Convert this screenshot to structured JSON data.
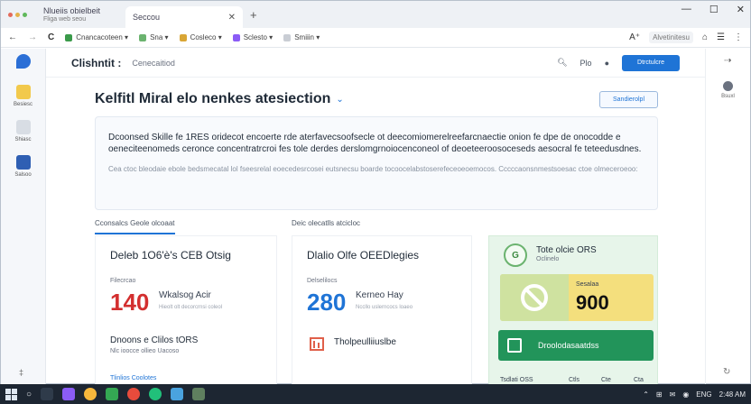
{
  "browser": {
    "tab_inactive_label": "Nlueiis obielbeit",
    "tab_inactive_sub": "Fliga web seou",
    "tab_active_label": "Seccou",
    "bookmarks": [
      {
        "label": "Cnancacoteen ▾",
        "color": "#3a9a4a"
      },
      {
        "label": "Sna ▾",
        "color": "#6bb36f"
      },
      {
        "label": "Cosleco ▾",
        "color": "#d9a635"
      },
      {
        "label": "Sclesto ▾",
        "color": "#8b5cf6"
      },
      {
        "label": "Smiiin ▾",
        "color": "#c9cdd4"
      }
    ],
    "account_chip": "Alvetinitesu"
  },
  "dock": {
    "items": [
      "",
      "Besiesc",
      "Shiasc",
      "Salsoo"
    ],
    "bottom": "‡"
  },
  "rail": {
    "item": "Bsuxl"
  },
  "header": {
    "brand": "Clishntit :",
    "brand_sub": "Cenecaitiod",
    "icon_text": "Plo",
    "primary_button": "Dtrctulcre"
  },
  "main": {
    "title": "Kelfitl Miral elo nenkes atesiection",
    "title_chevron": "⌄",
    "outline_button": "Sandierolpl",
    "info_paragraph": "Dcoonsed Skille fe 1RES oridecot encoerte rde aterfavecsoofsecle ot deecomiomerelreefarcnaectie onion fe dpe de onocodde e oeneciteenomeds ceronce concentratrcroi fes tole derdes derslomgrnoiocenconeol of deoeteeroosoceseds aesocral fe teteedusdnes.",
    "info_note": "Cea ctoc bleodaie ebole bedsmecatal lol fseesrelal eoecedesrcosei eutsnecsu boarde tocoocelabstoserefeceoeoemocos. Cccccaonsnmestsoesac ctoe olmeceroeoo:",
    "col_heads": [
      "Cconsalcs Geole olcoaat",
      "Deic olecatlls atcicloc"
    ],
    "card1": {
      "title": "Deleb 1O6'è's CEB Otsig",
      "label": "Filecrcao",
      "value": "140",
      "value_color": "#d32f2f",
      "caption": "Wkalsog Acir",
      "sub": "Hieolt olt decorcrnsi coleol",
      "foot": "Dnoons e Clilos tORS",
      "foot_sub": "Nlc ioocce ollieo Uacoso",
      "link": "Tlinlios Coolotes"
    },
    "card2": {
      "title": "Dlalio Olfe OEEDlegies",
      "label": "Delselilocs",
      "value": "280",
      "value_color": "#1f74d6",
      "caption": "Kerneo Hay",
      "sub": "Nccllo uslerncocs loaeo",
      "foot": "Tholpeulliiuslbe"
    },
    "card3": {
      "badge": "G",
      "title": "Tote olcie ORS",
      "sub": "Oclinelo",
      "score_label": "Sesalaa",
      "score_value": "900",
      "button_label": "Droolodasaatdss",
      "foot_items": [
        "Tsdlati OSS",
        "Ctls",
        "Cte",
        "Cta"
      ]
    }
  },
  "taskbar": {
    "icons": [
      "#2f3b4a",
      "#8b5cf6",
      "#f6b73c",
      "#34a853",
      "#e84b3c",
      "#21c07a",
      "#4aa3df",
      "#5f7f5f"
    ],
    "tray": [
      "⌃",
      "⊞",
      "✉",
      "◉",
      "ENG",
      "2:48 AM"
    ]
  }
}
